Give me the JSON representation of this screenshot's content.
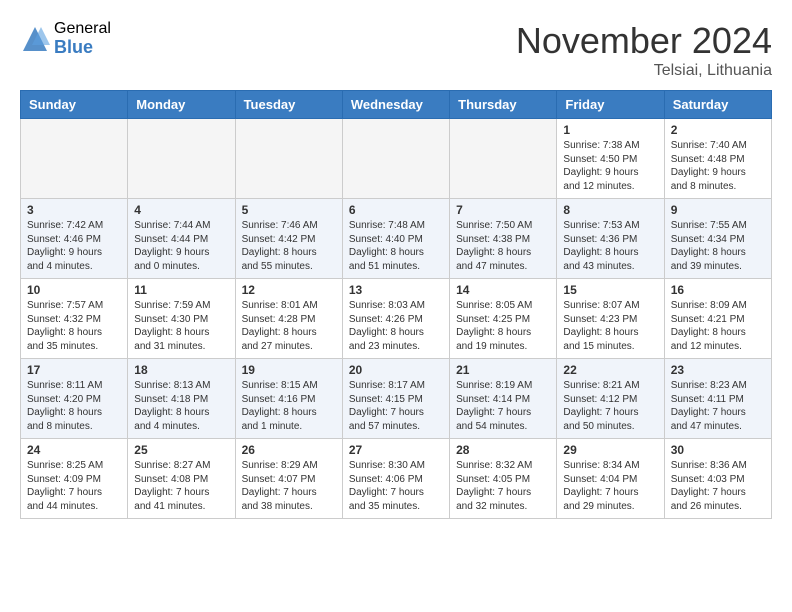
{
  "header": {
    "logo_general": "General",
    "logo_blue": "Blue",
    "month_year": "November 2024",
    "location": "Telsiai, Lithuania"
  },
  "days_of_week": [
    "Sunday",
    "Monday",
    "Tuesday",
    "Wednesday",
    "Thursday",
    "Friday",
    "Saturday"
  ],
  "weeks": [
    [
      {
        "day": "",
        "info": ""
      },
      {
        "day": "",
        "info": ""
      },
      {
        "day": "",
        "info": ""
      },
      {
        "day": "",
        "info": ""
      },
      {
        "day": "",
        "info": ""
      },
      {
        "day": "1",
        "info": "Sunrise: 7:38 AM\nSunset: 4:50 PM\nDaylight: 9 hours and 12 minutes."
      },
      {
        "day": "2",
        "info": "Sunrise: 7:40 AM\nSunset: 4:48 PM\nDaylight: 9 hours and 8 minutes."
      }
    ],
    [
      {
        "day": "3",
        "info": "Sunrise: 7:42 AM\nSunset: 4:46 PM\nDaylight: 9 hours and 4 minutes."
      },
      {
        "day": "4",
        "info": "Sunrise: 7:44 AM\nSunset: 4:44 PM\nDaylight: 9 hours and 0 minutes."
      },
      {
        "day": "5",
        "info": "Sunrise: 7:46 AM\nSunset: 4:42 PM\nDaylight: 8 hours and 55 minutes."
      },
      {
        "day": "6",
        "info": "Sunrise: 7:48 AM\nSunset: 4:40 PM\nDaylight: 8 hours and 51 minutes."
      },
      {
        "day": "7",
        "info": "Sunrise: 7:50 AM\nSunset: 4:38 PM\nDaylight: 8 hours and 47 minutes."
      },
      {
        "day": "8",
        "info": "Sunrise: 7:53 AM\nSunset: 4:36 PM\nDaylight: 8 hours and 43 minutes."
      },
      {
        "day": "9",
        "info": "Sunrise: 7:55 AM\nSunset: 4:34 PM\nDaylight: 8 hours and 39 minutes."
      }
    ],
    [
      {
        "day": "10",
        "info": "Sunrise: 7:57 AM\nSunset: 4:32 PM\nDaylight: 8 hours and 35 minutes."
      },
      {
        "day": "11",
        "info": "Sunrise: 7:59 AM\nSunset: 4:30 PM\nDaylight: 8 hours and 31 minutes."
      },
      {
        "day": "12",
        "info": "Sunrise: 8:01 AM\nSunset: 4:28 PM\nDaylight: 8 hours and 27 minutes."
      },
      {
        "day": "13",
        "info": "Sunrise: 8:03 AM\nSunset: 4:26 PM\nDaylight: 8 hours and 23 minutes."
      },
      {
        "day": "14",
        "info": "Sunrise: 8:05 AM\nSunset: 4:25 PM\nDaylight: 8 hours and 19 minutes."
      },
      {
        "day": "15",
        "info": "Sunrise: 8:07 AM\nSunset: 4:23 PM\nDaylight: 8 hours and 15 minutes."
      },
      {
        "day": "16",
        "info": "Sunrise: 8:09 AM\nSunset: 4:21 PM\nDaylight: 8 hours and 12 minutes."
      }
    ],
    [
      {
        "day": "17",
        "info": "Sunrise: 8:11 AM\nSunset: 4:20 PM\nDaylight: 8 hours and 8 minutes."
      },
      {
        "day": "18",
        "info": "Sunrise: 8:13 AM\nSunset: 4:18 PM\nDaylight: 8 hours and 4 minutes."
      },
      {
        "day": "19",
        "info": "Sunrise: 8:15 AM\nSunset: 4:16 PM\nDaylight: 8 hours and 1 minute."
      },
      {
        "day": "20",
        "info": "Sunrise: 8:17 AM\nSunset: 4:15 PM\nDaylight: 7 hours and 57 minutes."
      },
      {
        "day": "21",
        "info": "Sunrise: 8:19 AM\nSunset: 4:14 PM\nDaylight: 7 hours and 54 minutes."
      },
      {
        "day": "22",
        "info": "Sunrise: 8:21 AM\nSunset: 4:12 PM\nDaylight: 7 hours and 50 minutes."
      },
      {
        "day": "23",
        "info": "Sunrise: 8:23 AM\nSunset: 4:11 PM\nDaylight: 7 hours and 47 minutes."
      }
    ],
    [
      {
        "day": "24",
        "info": "Sunrise: 8:25 AM\nSunset: 4:09 PM\nDaylight: 7 hours and 44 minutes."
      },
      {
        "day": "25",
        "info": "Sunrise: 8:27 AM\nSunset: 4:08 PM\nDaylight: 7 hours and 41 minutes."
      },
      {
        "day": "26",
        "info": "Sunrise: 8:29 AM\nSunset: 4:07 PM\nDaylight: 7 hours and 38 minutes."
      },
      {
        "day": "27",
        "info": "Sunrise: 8:30 AM\nSunset: 4:06 PM\nDaylight: 7 hours and 35 minutes."
      },
      {
        "day": "28",
        "info": "Sunrise: 8:32 AM\nSunset: 4:05 PM\nDaylight: 7 hours and 32 minutes."
      },
      {
        "day": "29",
        "info": "Sunrise: 8:34 AM\nSunset: 4:04 PM\nDaylight: 7 hours and 29 minutes."
      },
      {
        "day": "30",
        "info": "Sunrise: 8:36 AM\nSunset: 4:03 PM\nDaylight: 7 hours and 26 minutes."
      }
    ]
  ]
}
